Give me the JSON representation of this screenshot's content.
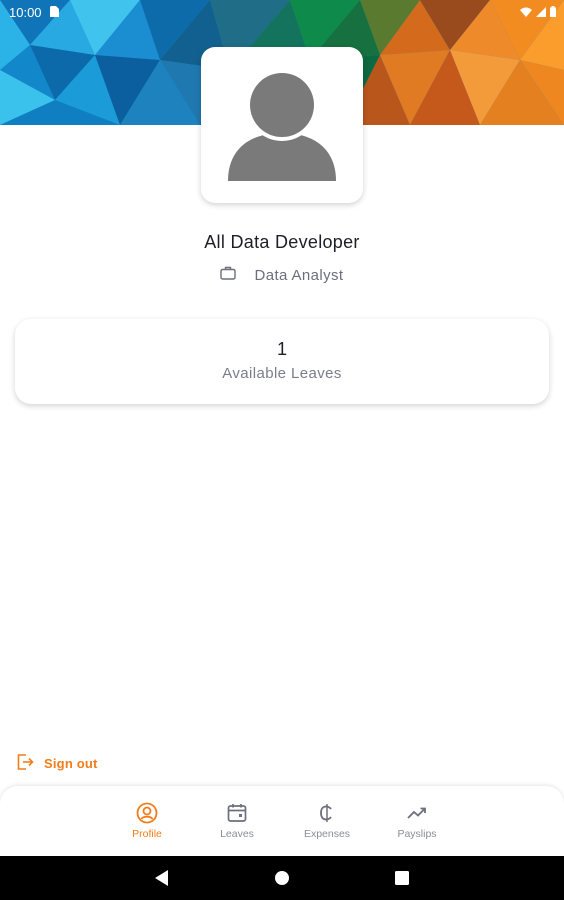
{
  "status_bar": {
    "time": "10:00",
    "icons": [
      "sim-card-icon",
      "wifi-icon",
      "signal-icon",
      "battery-icon"
    ]
  },
  "profile": {
    "name": "All Data Developer",
    "role": "Data Analyst",
    "avatar_icon": "person-placeholder-icon"
  },
  "leaves_summary": {
    "count": "1",
    "label": "Available Leaves"
  },
  "sign_out": {
    "label": "Sign out",
    "icon": "logout-icon"
  },
  "bottom_nav": {
    "items": [
      {
        "label": "Profile",
        "icon": "profile-icon",
        "active": true
      },
      {
        "label": "Leaves",
        "icon": "calendar-icon",
        "active": false
      },
      {
        "label": "Expenses",
        "icon": "cedi-currency-icon",
        "active": false
      },
      {
        "label": "Payslips",
        "icon": "trending-up-icon",
        "active": false
      }
    ]
  },
  "colors": {
    "accent": "#f07d1a",
    "text_primary": "#1e1e28",
    "text_secondary": "#6c6f7c",
    "nav_inactive": "#8a8d98"
  }
}
